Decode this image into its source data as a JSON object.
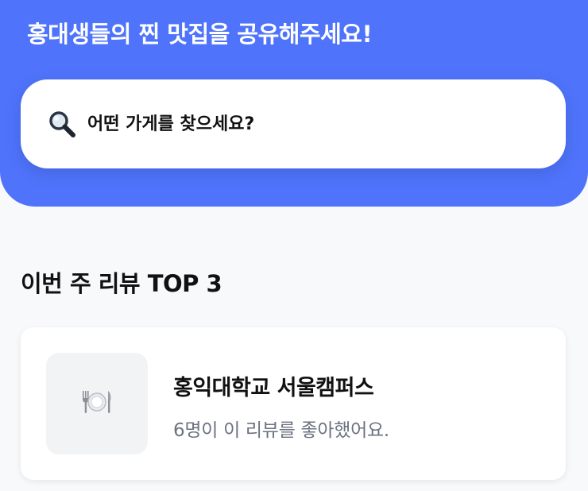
{
  "header": {
    "title": "홍대생들의 찐 맛집을 공유해주세요!",
    "background_color": "#4f74fb"
  },
  "search": {
    "icon": "magnifying-glass-icon",
    "placeholder": "어떤 가게를 찾으세요?"
  },
  "top_reviews": {
    "section_title": "이번 주 리뷰 TOP 3",
    "items": [
      {
        "thumbnail_icon": "plate-utensils-icon",
        "name": "홍익대학교 서울캠퍼스",
        "likes_text": "6명이 이 리뷰를 좋아했어요."
      }
    ]
  }
}
